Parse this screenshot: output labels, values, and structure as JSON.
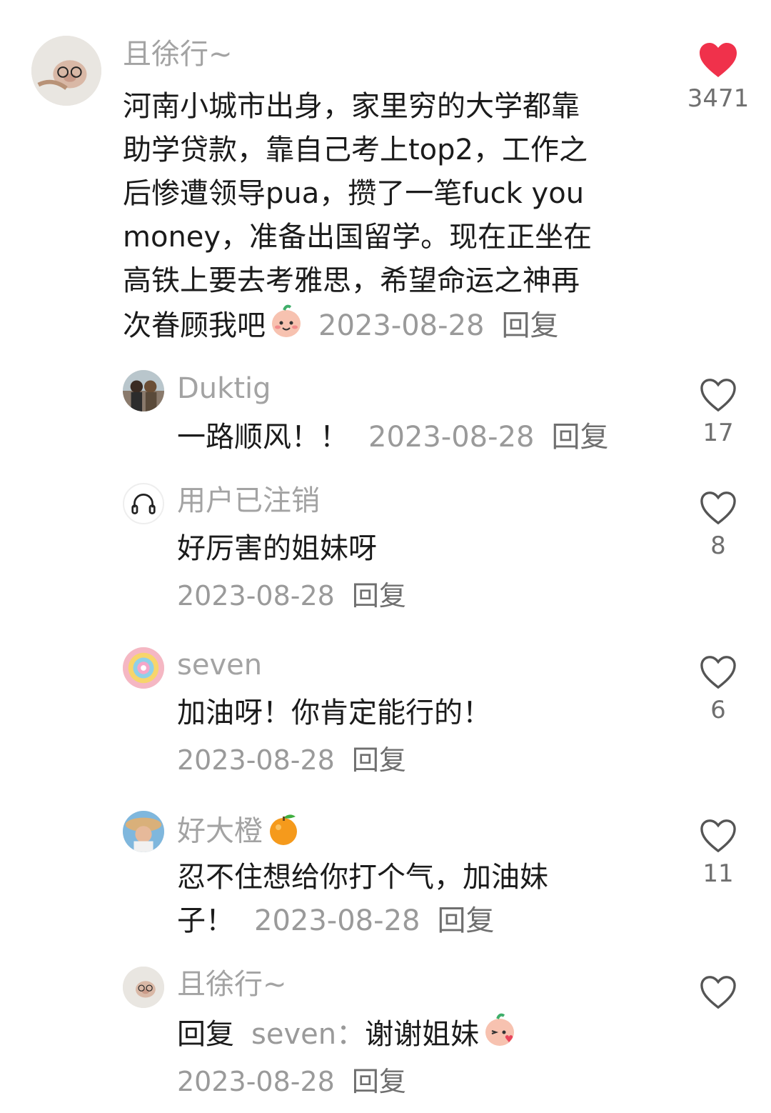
{
  "main_comment": {
    "username": "且徐行~",
    "lines": [
      "河南小城市出身，家里穷的大学都靠",
      "助学贷款，靠自己考上top2，工作之",
      "后惨遭领导pua，攒了一笔fuck you",
      "money，准备出国留学。现在正坐在",
      "高铁上要去考雅思，希望命运之神再",
      "次眷顾我吧"
    ],
    "date": "2023-08-28",
    "reply_label": "回复",
    "likes": "3471",
    "liked": true
  },
  "replies": [
    {
      "username": "Duktig",
      "text": "一路顺风！！",
      "date": "2023-08-28",
      "reply_label": "回复",
      "likes": "17"
    },
    {
      "username": "用户已注销",
      "text": "好厉害的姐妹呀",
      "date": "2023-08-28",
      "reply_label": "回复",
      "likes": "8"
    },
    {
      "username": "seven",
      "text": "加油呀！你肯定能行的！",
      "date": "2023-08-28",
      "reply_label": "回复",
      "likes": "6"
    },
    {
      "username": "好大橙",
      "text_line1": "忍不住想给你打个气，加油妹",
      "text_line2": "子！",
      "date": "2023-08-28",
      "reply_label": "回复",
      "likes": "11"
    },
    {
      "username": "且徐行~",
      "reply_prefix": "回复",
      "reply_target": "seven：",
      "text": "谢谢姐妹",
      "date": "2023-08-28",
      "reply_label": "回复",
      "likes": ""
    }
  ],
  "colors": {
    "liked_heart": "#f0314b",
    "heart_outline": "#555555",
    "meta_text": "#9a9a9a"
  }
}
